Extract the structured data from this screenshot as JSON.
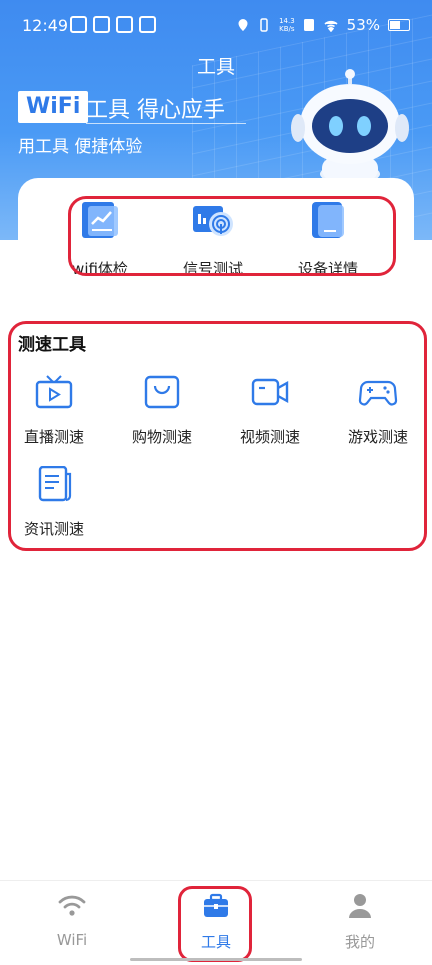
{
  "status_bar": {
    "time": "12:49",
    "speed_value": "14.3",
    "speed_unit": "KB/s",
    "battery": "53%"
  },
  "header": {
    "title": "工具",
    "badge": "WiFi",
    "slogan": "工具 得心应手",
    "subtitle": "用工具 便捷体验"
  },
  "quick_tools": [
    {
      "label": "wifi体检",
      "icon": "report-chart-icon"
    },
    {
      "label": "信号测试",
      "icon": "signal-test-icon"
    },
    {
      "label": "设备详情",
      "icon": "device-detail-icon"
    }
  ],
  "speed_tools": {
    "title": "测速工具",
    "items": [
      {
        "label": "直播测速",
        "icon": "tv-live-icon"
      },
      {
        "label": "购物测速",
        "icon": "shopping-bag-icon"
      },
      {
        "label": "视频测速",
        "icon": "video-camera-icon"
      },
      {
        "label": "游戏测速",
        "icon": "gamepad-icon"
      },
      {
        "label": "资讯测速",
        "icon": "news-document-icon"
      }
    ]
  },
  "tabbar": {
    "tabs": [
      {
        "label": "WiFi",
        "icon": "wifi-icon",
        "active": false
      },
      {
        "label": "工具",
        "icon": "toolbox-icon",
        "active": true
      },
      {
        "label": "我的",
        "icon": "user-icon",
        "active": false
      }
    ]
  },
  "colors": {
    "brand_blue": "#2f7ae8",
    "highlight_red": "#e0243a",
    "inactive_gray": "#999999"
  }
}
